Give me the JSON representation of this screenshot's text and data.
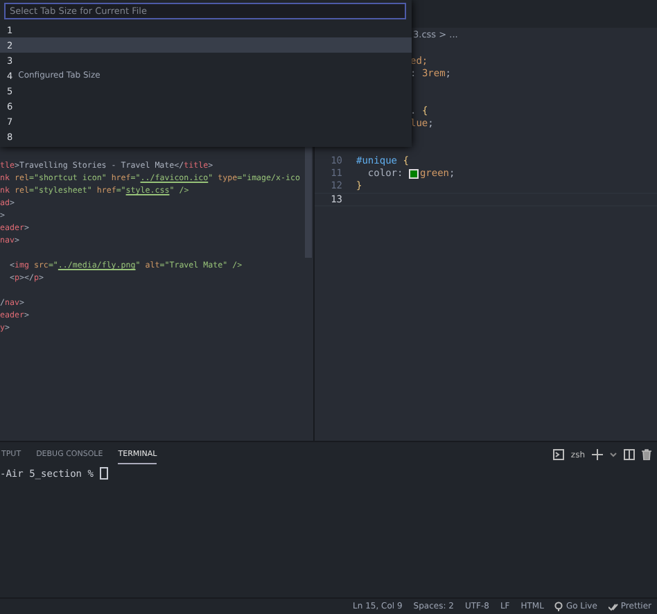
{
  "quick_pick": {
    "placeholder": "Select Tab Size for Current File",
    "items": [
      {
        "label": "1",
        "selected": false
      },
      {
        "label": "2",
        "selected": true
      },
      {
        "label": "3",
        "selected": false
      },
      {
        "label": "4",
        "description": "Configured Tab Size",
        "selected": false
      },
      {
        "label": "5",
        "selected": false
      },
      {
        "label": "6",
        "selected": false
      },
      {
        "label": "7",
        "selected": false
      },
      {
        "label": "8",
        "selected": false
      }
    ]
  },
  "left_editor": {
    "lines": [
      {
        "kind": "code",
        "tokens": [
          {
            "text": "tle",
            "kind": "tag"
          },
          {
            "text": ">Travelling Stories - Travel Mate</",
            "kind": "plain"
          },
          {
            "text": "title",
            "kind": "tag"
          },
          {
            "text": ">",
            "kind": "plain"
          }
        ]
      },
      {
        "kind": "code",
        "tokens": [
          {
            "text": "nk ",
            "kind": "tag"
          },
          {
            "text": "rel",
            "kind": "attr"
          },
          {
            "text": "=\"shortcut icon\" ",
            "kind": "string"
          },
          {
            "text": "href",
            "kind": "attr"
          },
          {
            "text": "=\"",
            "kind": "string"
          },
          {
            "text": "../favicon.ico",
            "kind": "link"
          },
          {
            "text": "\" ",
            "kind": "string"
          },
          {
            "text": "type",
            "kind": "attr"
          },
          {
            "text": "=\"image/x-ico",
            "kind": "string"
          }
        ]
      },
      {
        "kind": "code",
        "tokens": [
          {
            "text": "nk ",
            "kind": "tag"
          },
          {
            "text": "rel",
            "kind": "attr"
          },
          {
            "text": "=\"stylesheet\" ",
            "kind": "string"
          },
          {
            "text": "href",
            "kind": "attr"
          },
          {
            "text": "=\"",
            "kind": "string"
          },
          {
            "text": "style.css",
            "kind": "link"
          },
          {
            "text": "\" />",
            "kind": "string"
          }
        ]
      },
      {
        "kind": "code",
        "tokens": [
          {
            "text": "ad",
            "kind": "tag"
          },
          {
            "text": ">",
            "kind": "plain"
          }
        ]
      },
      {
        "kind": "code",
        "tokens": [
          {
            "text": ">",
            "kind": "plain"
          }
        ]
      },
      {
        "kind": "code",
        "tokens": [
          {
            "text": "eader",
            "kind": "tag"
          },
          {
            "text": ">",
            "kind": "plain"
          }
        ]
      },
      {
        "kind": "code",
        "tokens": [
          {
            "text": "nav",
            "kind": "tag"
          },
          {
            "text": ">",
            "kind": "plain"
          }
        ]
      },
      {
        "kind": "blank"
      },
      {
        "kind": "code",
        "tokens": [
          {
            "text": "  <",
            "kind": "plain"
          },
          {
            "text": "img ",
            "kind": "tag"
          },
          {
            "text": "src",
            "kind": "attr"
          },
          {
            "text": "=\"",
            "kind": "string"
          },
          {
            "text": "../media/fly.png",
            "kind": "link"
          },
          {
            "text": "\" ",
            "kind": "string"
          },
          {
            "text": "alt",
            "kind": "attr"
          },
          {
            "text": "=\"Travel Mate\" />",
            "kind": "string"
          }
        ]
      },
      {
        "kind": "code",
        "tokens": [
          {
            "text": "  <",
            "kind": "plain"
          },
          {
            "text": "p",
            "kind": "tag"
          },
          {
            "text": "></",
            "kind": "plain"
          },
          {
            "text": "p",
            "kind": "tag"
          },
          {
            "text": ">",
            "kind": "plain"
          }
        ]
      },
      {
        "kind": "blank"
      },
      {
        "kind": "code",
        "tokens": [
          {
            "text": "/",
            "kind": "plain"
          },
          {
            "text": "nav",
            "kind": "tag"
          },
          {
            "text": ">",
            "kind": "plain"
          }
        ]
      },
      {
        "kind": "code",
        "tokens": [
          {
            "text": "eader",
            "kind": "tag"
          },
          {
            "text": ">",
            "kind": "plain"
          }
        ]
      },
      {
        "kind": "code",
        "tokens": [
          {
            "text": "y",
            "kind": "tag"
          },
          {
            "text": ">",
            "kind": "plain"
          }
        ]
      }
    ]
  },
  "right_editor": {
    "breadcrumb": "3.css > ...",
    "lines": [
      {
        "kind": "blank"
      },
      {
        "kind": "partial",
        "tokens": [
          {
            "text": "ed;",
            "kind": "value"
          }
        ]
      },
      {
        "kind": "partial",
        "tokens": [
          {
            "text": ": ",
            "kind": "plain"
          },
          {
            "text": "3rem",
            "kind": "value"
          },
          {
            "text": ";",
            "kind": "plain"
          }
        ]
      },
      {
        "kind": "blank"
      },
      {
        "kind": "blank"
      },
      {
        "kind": "partial",
        "tokens": [
          {
            "text": ". ",
            "kind": "plain"
          },
          {
            "text": "{",
            "kind": "brace"
          }
        ]
      },
      {
        "kind": "partial",
        "tokens": [
          {
            "text": "lue",
            "kind": "value"
          },
          {
            "text": ";",
            "kind": "plain"
          }
        ]
      },
      {
        "kind": "blank"
      },
      {
        "kind": "blank"
      },
      {
        "kind": "numbered",
        "number": "10",
        "current": false,
        "tokens": [
          {
            "text": "#unique ",
            "kind": "selector"
          },
          {
            "text": "{",
            "kind": "brace"
          }
        ]
      },
      {
        "kind": "numbered",
        "number": "11",
        "current": false,
        "tokens": [
          {
            "text": "  color: ",
            "kind": "plain"
          },
          {
            "text": "green",
            "kind": "value",
            "color": "#008000"
          },
          {
            "text": ";",
            "kind": "plain"
          }
        ]
      },
      {
        "kind": "numbered",
        "number": "12",
        "current": false,
        "tokens": [
          {
            "text": "}",
            "kind": "brace"
          }
        ]
      },
      {
        "kind": "numbered",
        "number": "13",
        "current": true
      }
    ]
  },
  "panel": {
    "tabs": [
      {
        "label": "TPUT",
        "selected": false
      },
      {
        "label": "DEBUG CONSOLE",
        "selected": false
      },
      {
        "label": "TERMINAL",
        "selected": true
      }
    ],
    "shell": "zsh",
    "terminal_line": "-Air 5_section % "
  },
  "status_bar": {
    "items": [
      {
        "label": "Ln 15, Col 9",
        "kind": "text"
      },
      {
        "label": "Spaces: 2",
        "kind": "text"
      },
      {
        "label": "UTF-8",
        "kind": "text"
      },
      {
        "label": "LF",
        "kind": "text"
      },
      {
        "label": "HTML",
        "kind": "text"
      },
      {
        "label": "Go Live",
        "kind": "golive"
      },
      {
        "label": "Prettier",
        "kind": "prettier"
      }
    ]
  }
}
